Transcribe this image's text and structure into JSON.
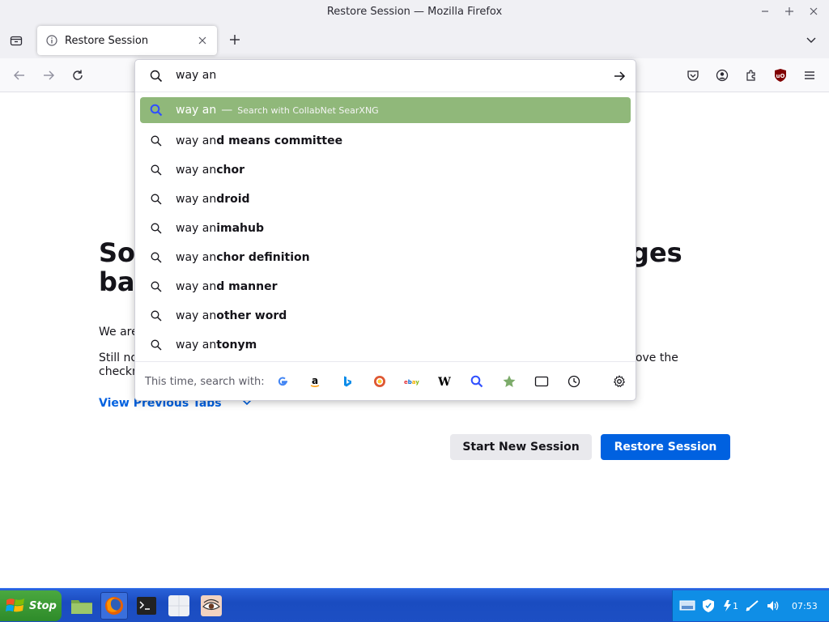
{
  "window": {
    "title": "Restore Session — Mozilla Firefox"
  },
  "tabs": [
    {
      "label": "Restore Session"
    }
  ],
  "urlbar": {
    "value": "way an",
    "placeholder": ""
  },
  "suggestions": {
    "selected": {
      "query": "way an",
      "separator": "—",
      "action": "Search with CollabNet SearXNG"
    },
    "items": [
      {
        "prefix": "way an",
        "completion": "d means committee"
      },
      {
        "prefix": "way an",
        "completion": "chor"
      },
      {
        "prefix": "way an",
        "completion": "droid"
      },
      {
        "prefix": "way an",
        "completion": "imahub"
      },
      {
        "prefix": "way an",
        "completion": "chor definition"
      },
      {
        "prefix": "way an",
        "completion": "d manner"
      },
      {
        "prefix": "way an",
        "completion": "other word"
      },
      {
        "prefix": "way an",
        "completion": "tonym"
      }
    ]
  },
  "oneoff": {
    "label": "This time, search with:",
    "engines": [
      {
        "name": "google-icon",
        "glyph": "G",
        "color": "#4285f4"
      },
      {
        "name": "amazon-icon",
        "glyph": "a",
        "color": "#000000"
      },
      {
        "name": "bing-icon",
        "glyph": "b",
        "color": "#0c8ce9"
      },
      {
        "name": "duckduckgo-icon",
        "glyph": "●",
        "color": "#de5833"
      },
      {
        "name": "ebay-icon",
        "glyph": "ebay",
        "color": "#e53238"
      },
      {
        "name": "wikipedia-icon",
        "glyph": "W",
        "color": "#000000"
      },
      {
        "name": "searxng-icon",
        "glyph": "🔍",
        "color": "#3050ff"
      },
      {
        "name": "bookmarks-icon",
        "glyph": "★",
        "color": "#7cab6a"
      },
      {
        "name": "tabs-icon",
        "glyph": "▭",
        "color": "#15141a"
      },
      {
        "name": "history-icon",
        "glyph": "◷",
        "color": "#15141a"
      }
    ]
  },
  "page": {
    "heading_visible_left": "So",
    "heading_visible_right": "ges",
    "heading_line2_left": "ba",
    "text1_left": "We are",
    "text2_left": "Still no",
    "text2_right": "ove the",
    "text2_line2_left": "checkn",
    "view_previous_tabs": "View Previous Tabs",
    "start_new_session": "Start New Session",
    "restore_session": "Restore Session"
  },
  "taskbar": {
    "start_label": "Stop",
    "tray_badge": "1",
    "clock": "07:53"
  },
  "colors": {
    "accent": "#0061e0",
    "selected_suggestion": "#90b87a",
    "taskbar": "#1d4fc4",
    "tray": "#0f8ee6",
    "start": "#2e8b2a"
  }
}
